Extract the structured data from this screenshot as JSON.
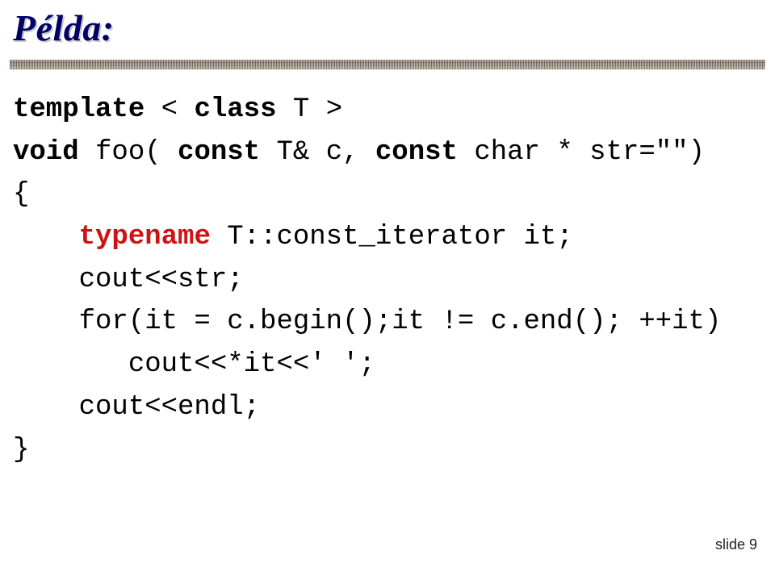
{
  "title": "Példa:",
  "code": {
    "l1_a": "template",
    "l1_b": " < ",
    "l1_c": "class",
    "l1_d": " T >",
    "l2_a": "void",
    "l2_b": " foo( ",
    "l2_c": "const",
    "l2_d": " T& c, ",
    "l2_e": "const",
    "l2_f": " char * str=\"\")",
    "l3": "{",
    "l4_a": "    ",
    "l4_b": "typename",
    "l4_c": " T::const_iterator it;",
    "l5": "    cout<<str;",
    "l6": "    for(it = c.begin();it != c.end(); ++it)",
    "l7": "       cout<<*it<<' ';",
    "l8": "    cout<<endl;",
    "l9": "}"
  },
  "footer": "slide 9"
}
